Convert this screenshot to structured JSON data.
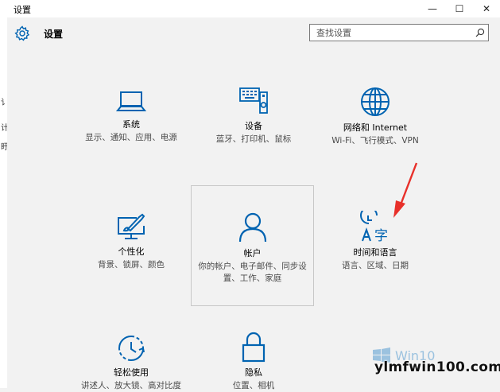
{
  "window": {
    "title": "设置",
    "minimize": "—",
    "maximize": "☐",
    "close": "✕"
  },
  "header": {
    "title": "设置",
    "search_placeholder": "查找设置"
  },
  "left_strip": {
    "chars": [
      "讠",
      "计",
      "盱"
    ]
  },
  "tiles": [
    {
      "name": "系统",
      "desc": "显示、通知、应用、电源",
      "icon": "laptop-icon"
    },
    {
      "name": "设备",
      "desc": "蓝牙、打印机、鼠标",
      "icon": "devices-icon"
    },
    {
      "name": "网络和 Internet",
      "desc": "Wi-Fi、飞行模式、VPN",
      "icon": "globe-icon"
    },
    {
      "name": "个性化",
      "desc": "背景、锁屏、颜色",
      "icon": "personalize-icon"
    },
    {
      "name": "帐户",
      "desc": "你的帐户、电子邮件、同步设置、工作、家庭",
      "icon": "person-icon"
    },
    {
      "name": "时间和语言",
      "desc": "语言、区域、日期",
      "icon": "time-language-icon"
    },
    {
      "name": "轻松使用",
      "desc": "讲述人、放大镜、高对比度",
      "icon": "ease-of-access-icon"
    },
    {
      "name": "隐私",
      "desc": "位置、相机",
      "icon": "lock-icon"
    }
  ],
  "annotation": {
    "arrow_color": "#e8302a"
  },
  "watermark": {
    "text": "ylmfwin100.com",
    "logo_text": "Win10"
  },
  "colors": {
    "accent": "#0063b1",
    "background": "#f2f2f2"
  }
}
